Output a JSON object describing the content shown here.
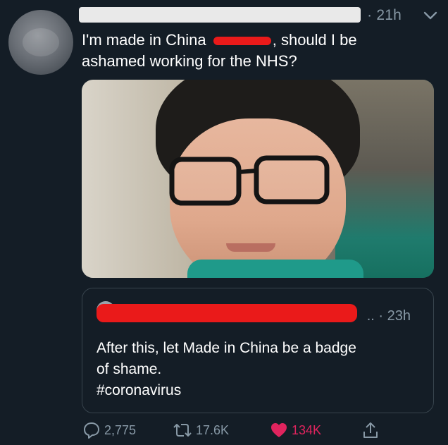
{
  "tweet": {
    "time": "· 21h",
    "text_line1_part1": "I'm made in China ",
    "text_line1_part2": ", should I be",
    "text_line2": "ashamed working for the NHS?"
  },
  "quote": {
    "time": ".. · 23h",
    "text_line1": "After this, let Made in China be a badge",
    "text_line2": "of shame.",
    "text_line3": "#coronavirus"
  },
  "actions": {
    "replies": "2,775",
    "retweets": "17.6K",
    "likes": "134K"
  },
  "colors": {
    "background": "#141d26",
    "secondary_text": "#8899a6",
    "like": "#e0245e",
    "redaction": "#ea1a1a"
  },
  "icons": [
    "reply-icon",
    "retweet-icon",
    "heart-icon",
    "share-icon",
    "chevron-down-icon"
  ]
}
